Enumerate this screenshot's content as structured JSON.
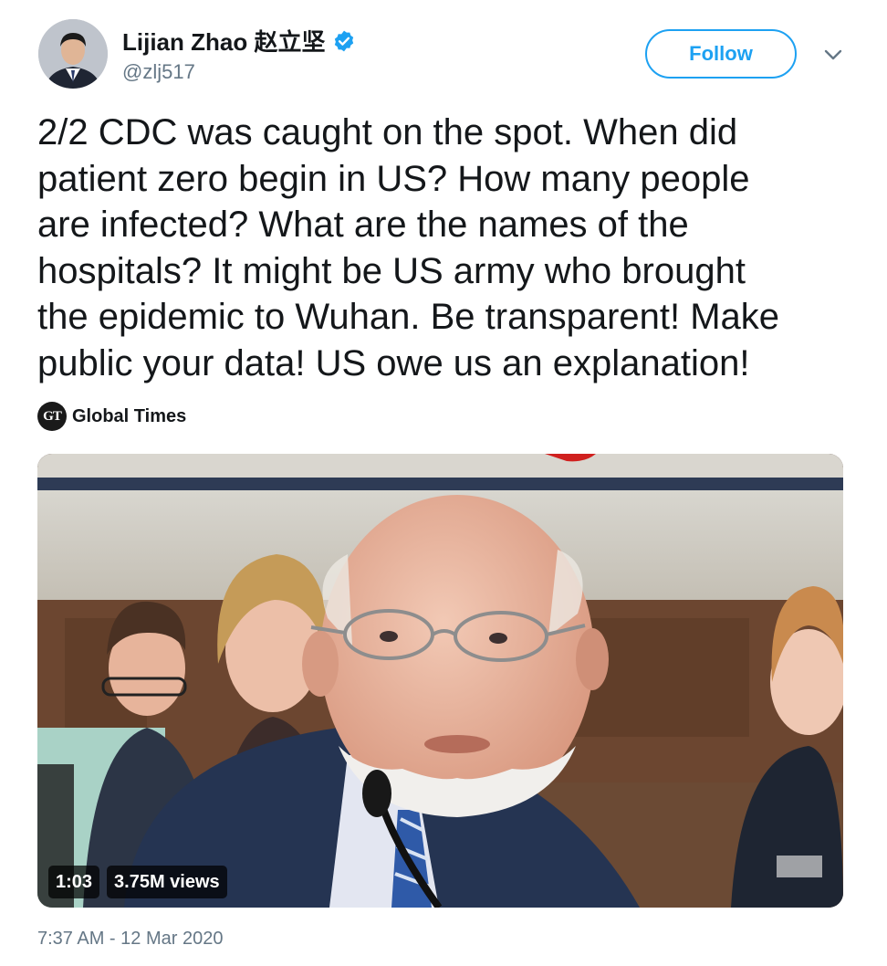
{
  "author": {
    "display_name": "Lijian Zhao 赵立坚",
    "handle": "@zlj517",
    "verified": true
  },
  "actions": {
    "follow_label": "Follow"
  },
  "tweet": {
    "text": "2/2 CDC was caught on the spot. When did\npatient zero begin in US? How many people\nare infected? What are the names of the\nhospitals? It might be US army who brought\nthe epidemic to Wuhan. Be transparent! Make\npublic your data! US owe us an explanation!",
    "timestamp": "7:37 AM - 12 Mar 2020"
  },
  "source": {
    "logo_text": "GT",
    "name": "Global Times"
  },
  "video": {
    "duration": "1:03",
    "views": "3.75M views"
  },
  "colors": {
    "accent": "#1da1f2",
    "text": "#14171a",
    "secondary": "#657786"
  }
}
